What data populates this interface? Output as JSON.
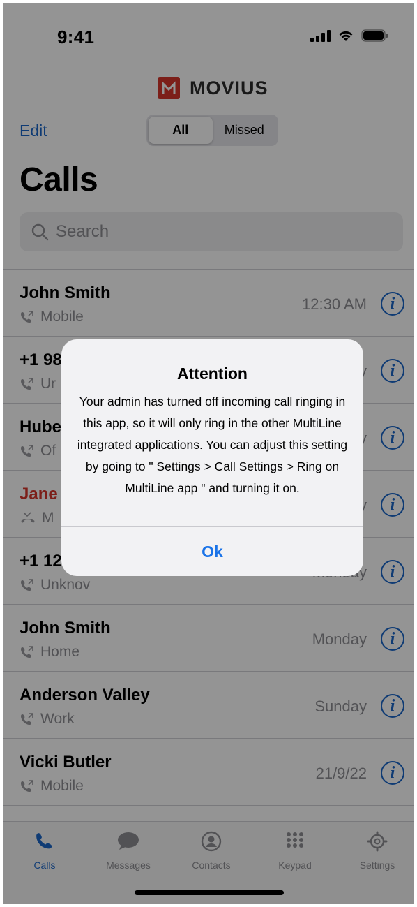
{
  "status_bar": {
    "time": "9:41"
  },
  "brand": {
    "name": "MOVIUS",
    "color": "#d6362b"
  },
  "header": {
    "edit_label": "Edit",
    "segments": [
      {
        "label": "All",
        "selected": true
      },
      {
        "label": "Missed",
        "selected": false
      }
    ],
    "title": "Calls"
  },
  "search": {
    "placeholder": "Search"
  },
  "calls": [
    {
      "name": "John Smith",
      "type": "Mobile",
      "time": "12:30 AM",
      "missed": false
    },
    {
      "name": "+1 98",
      "type": "Ur",
      "time": "y",
      "missed": false
    },
    {
      "name": "Hube",
      "type": "Of",
      "time": "y",
      "missed": false
    },
    {
      "name": "Jane",
      "type": "M",
      "time": "y",
      "missed": true
    },
    {
      "name": "+1 12",
      "type": "Unknov",
      "time": "Monday",
      "missed": false
    },
    {
      "name": "John Smith",
      "type": "Home",
      "time": "Monday",
      "missed": false
    },
    {
      "name": "Anderson Valley",
      "type": "Work",
      "time": "Sunday",
      "missed": false
    },
    {
      "name": "Vicki Butler",
      "type": "Mobile",
      "time": "21/9/22",
      "missed": false
    }
  ],
  "tabs": [
    {
      "label": "Calls",
      "icon": "phone-icon",
      "active": true
    },
    {
      "label": "Messages",
      "icon": "message-bubble-icon",
      "active": false
    },
    {
      "label": "Contacts",
      "icon": "contact-icon",
      "active": false
    },
    {
      "label": "Keypad",
      "icon": "keypad-icon",
      "active": false
    },
    {
      "label": "Settings",
      "icon": "gear-icon",
      "active": false
    }
  ],
  "alert": {
    "title": "Attention",
    "message": "Your admin has turned off incoming call ringing in this app, so it will only ring in the other MultiLine integrated applications. You can adjust this setting by going to \" Settings > Call Settings > Ring on MultiLine app \" and turning it on.",
    "button": "Ok"
  },
  "colors": {
    "accent": "#1a66c9",
    "missed": "#d6362b",
    "overlay": "rgba(0,0,0,0.42)"
  }
}
